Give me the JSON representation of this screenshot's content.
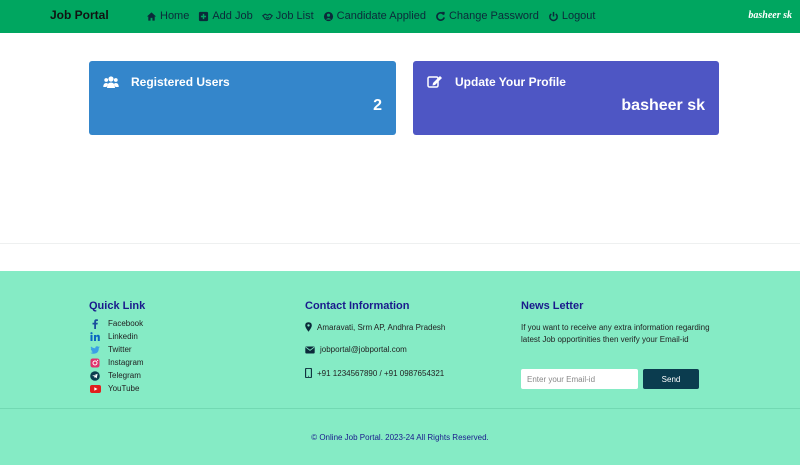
{
  "navbar": {
    "brand": "Job Portal",
    "items": [
      {
        "label": "Home",
        "icon": "home-icon"
      },
      {
        "label": "Add Job",
        "icon": "plus-square-icon"
      },
      {
        "label": "Job List",
        "icon": "handshake-icon"
      },
      {
        "label": "Candidate Applied",
        "icon": "user-circle-icon"
      },
      {
        "label": "Change Password",
        "icon": "refresh-icon"
      },
      {
        "label": "Logout",
        "icon": "power-icon"
      }
    ],
    "user": "basheer sk"
  },
  "cards": {
    "users": {
      "title": "Registered Users",
      "value": "2",
      "icon": "users-icon",
      "color": "#3486cb"
    },
    "profile": {
      "title": "Update Your Profile",
      "value": "basheer sk",
      "icon": "edit-icon",
      "color": "#4e56c4"
    }
  },
  "footer": {
    "quick_link": {
      "title": "Quick Link",
      "links": [
        {
          "label": "Facebook",
          "icon": "facebook-icon"
        },
        {
          "label": "Linkedin",
          "icon": "linkedin-icon"
        },
        {
          "label": "Twitter",
          "icon": "twitter-icon"
        },
        {
          "label": "Instagram",
          "icon": "instagram-icon"
        },
        {
          "label": "Telegram",
          "icon": "telegram-icon"
        },
        {
          "label": "YouTube",
          "icon": "youtube-icon"
        }
      ]
    },
    "contact": {
      "title": "Contact Information",
      "address": "Amaravati, Srm AP, Andhra Pradesh",
      "email": "jobportal@jobportal.com",
      "phone": "+91 1234567890 / +91 0987654321"
    },
    "newsletter": {
      "title": "News Letter",
      "text": "If you want to receive any extra information regarding latest Job opportinities then verify your Email-id",
      "placeholder": "Enter your Email-id",
      "button": "Send"
    },
    "copyright": "© Online Job Portal. 2023-24 All Rights Reserved."
  },
  "colors": {
    "navbar": "#00a660",
    "footer": "#85ebc5",
    "footer_heading": "#1a1a8c",
    "send_button": "#0b3c4f"
  }
}
